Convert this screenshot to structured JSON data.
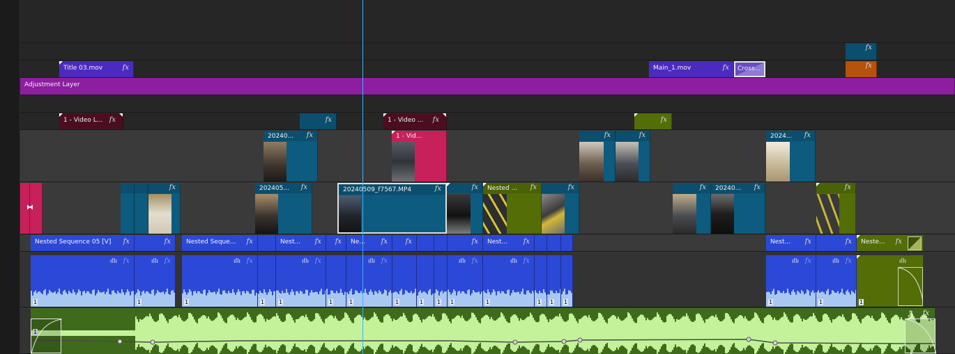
{
  "timeline": {
    "adjustment_label": "Adjustment Layer",
    "title03_label": "Title 03.mov",
    "main1_label": "Main_1.mov",
    "cross_label": "Cross...",
    "fx_label": "fx",
    "v4a_label": "1 - Video L...",
    "v4b_label": "1 - Video ...",
    "v3_clip1": "20240...",
    "v3_clip2": "1 - Vid...",
    "v3_clip3": "2024...",
    "v2_clip1": "202405...",
    "v2_clip_sel": "20240509_f7567.MP4",
    "v2_nested": "Nested ...",
    "v2_clip4": "20240...",
    "v1_nested_main": "Nested Sequence 05 [V]",
    "v1_nested_2": "Nested Seque...",
    "v1_nest_short": "Nest...",
    "v1_ne": "Ne...",
    "v1_neste": "Neste...",
    "a1_channel": "1",
    "music_icon": "music-note-icon",
    "colors": {
      "adjustment": "#8c1f9f",
      "title": "#4b2bbf",
      "teal": "#0d5b7e",
      "teal_header": "#0b4e6d",
      "nested_blue": "#2c48d6",
      "olive": "#536d07",
      "magenta": "#c7205a",
      "maroon": "#4a0e20",
      "orange": "#b4520e",
      "music_green": "#3f6a1c",
      "music_wave": "#c4f29a",
      "playhead": "#3ab3ff"
    }
  }
}
